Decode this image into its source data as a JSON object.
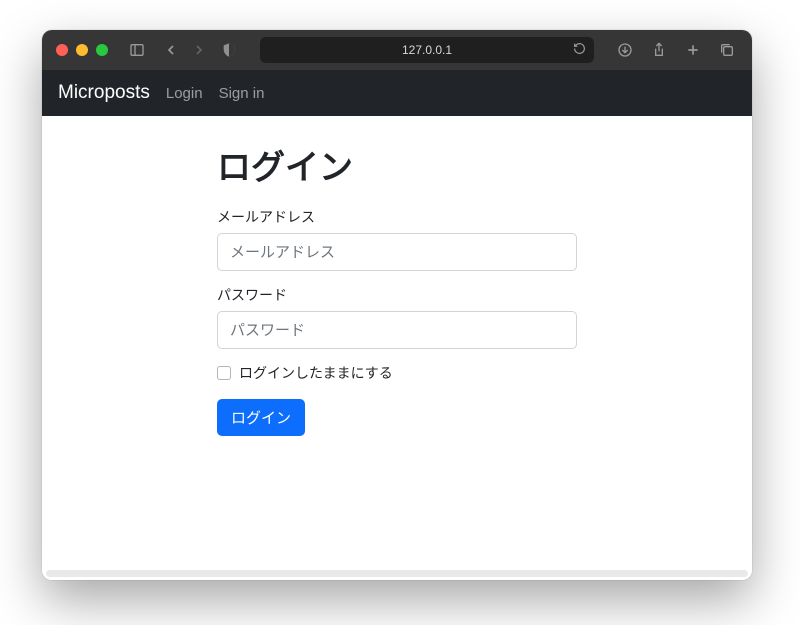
{
  "browser": {
    "address": "127.0.0.1"
  },
  "navbar": {
    "brand": "Microposts",
    "links": [
      "Login",
      "Sign in"
    ]
  },
  "page": {
    "title": "ログイン"
  },
  "form": {
    "email": {
      "label": "メールアドレス",
      "placeholder": "メールアドレス",
      "value": ""
    },
    "password": {
      "label": "パスワード",
      "placeholder": "パスワード",
      "value": ""
    },
    "remember": {
      "label": "ログインしたままにする",
      "checked": false
    },
    "submit": "ログイン"
  }
}
